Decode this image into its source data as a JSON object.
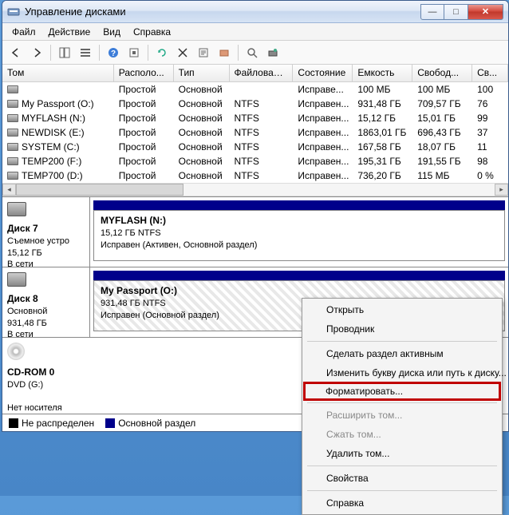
{
  "titlebar": {
    "title": "Управление дисками"
  },
  "menu": {
    "file": "Файл",
    "action": "Действие",
    "view": "Вид",
    "help": "Справка"
  },
  "columns": {
    "volume": "Том",
    "layout": "Располо...",
    "type": "Тип",
    "filesystem": "Файловая с...",
    "status": "Состояние",
    "capacity": "Емкость",
    "free": "Свобод...",
    "pct": "Св..."
  },
  "volumes": [
    {
      "name": "",
      "layout": "Простой",
      "type": "Основной",
      "fs": "",
      "status": "Исправе...",
      "cap": "100 МБ",
      "free": "100 МБ",
      "pct": "100"
    },
    {
      "name": "My Passport (O:)",
      "layout": "Простой",
      "type": "Основной",
      "fs": "NTFS",
      "status": "Исправен...",
      "cap": "931,48 ГБ",
      "free": "709,57 ГБ",
      "pct": "76"
    },
    {
      "name": "MYFLASH (N:)",
      "layout": "Простой",
      "type": "Основной",
      "fs": "NTFS",
      "status": "Исправен...",
      "cap": "15,12 ГБ",
      "free": "15,01 ГБ",
      "pct": "99"
    },
    {
      "name": "NEWDISK (E:)",
      "layout": "Простой",
      "type": "Основной",
      "fs": "NTFS",
      "status": "Исправен...",
      "cap": "1863,01 ГБ",
      "free": "696,43 ГБ",
      "pct": "37"
    },
    {
      "name": "SYSTEM (C:)",
      "layout": "Простой",
      "type": "Основной",
      "fs": "NTFS",
      "status": "Исправен...",
      "cap": "167,58 ГБ",
      "free": "18,07 ГБ",
      "pct": "11"
    },
    {
      "name": "TEMP200 (F:)",
      "layout": "Простой",
      "type": "Основной",
      "fs": "NTFS",
      "status": "Исправен...",
      "cap": "195,31 ГБ",
      "free": "191,55 ГБ",
      "pct": "98"
    },
    {
      "name": "TEMP700 (D:)",
      "layout": "Простой",
      "type": "Основной",
      "fs": "NTFS",
      "status": "Исправен...",
      "cap": "736,20 ГБ",
      "free": "115 МБ",
      "pct": "0 %"
    }
  ],
  "disk7": {
    "label": "Диск 7",
    "sub1": "Съемное устро",
    "sub2": "15,12 ГБ",
    "sub3": "В сети",
    "part_title": "MYFLASH  (N:)",
    "part_cap": "15,12 ГБ NTFS",
    "part_status": "Исправен (Активен, Основной раздел)"
  },
  "disk8": {
    "label": "Диск 8",
    "sub1": "Основной",
    "sub2": "931,48 ГБ",
    "sub3": "В сети",
    "part_title": "My Passport  (O:)",
    "part_cap": "931,48 ГБ NTFS",
    "part_status": "Исправен (Основной раздел)"
  },
  "cdrom": {
    "label": "CD-ROM 0",
    "sub1": "DVD (G:)",
    "sub2": "Нет носителя"
  },
  "legend": {
    "unalloc": "Не распределен",
    "primary": "Основной раздел"
  },
  "ctx": {
    "open": "Открыть",
    "explorer": "Проводник",
    "active": "Сделать раздел активным",
    "chletter": "Изменить букву диска или путь к диску...",
    "format": "Форматировать...",
    "extend": "Расширить том...",
    "shrink": "Сжать том...",
    "delete": "Удалить том...",
    "props": "Свойства",
    "help": "Справка"
  }
}
